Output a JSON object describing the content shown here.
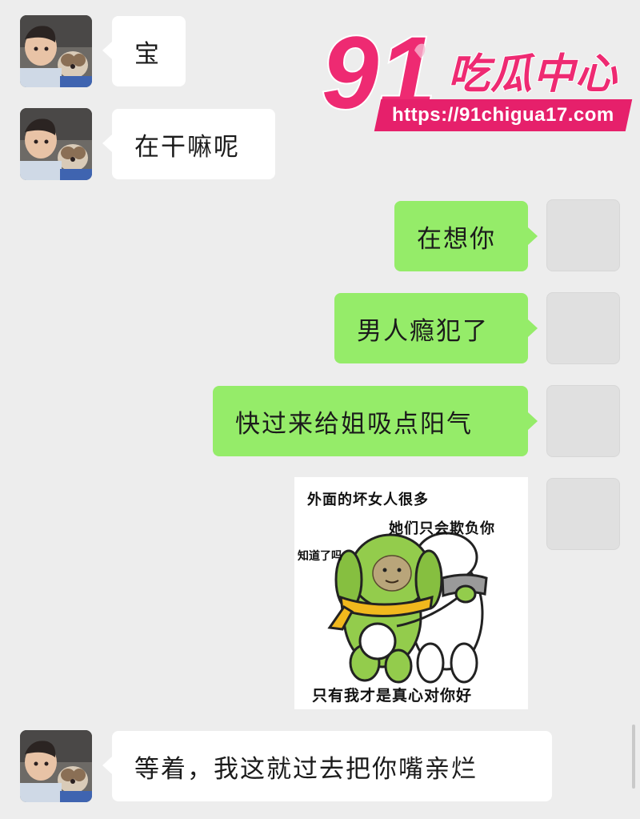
{
  "watermark": {
    "number": "91",
    "brand": "吃瓜中心",
    "url": "https://91chigua17.com"
  },
  "messages": [
    {
      "side": "in",
      "text": "宝"
    },
    {
      "side": "in",
      "text": "在干嘛呢"
    },
    {
      "side": "out",
      "text": "在想你"
    },
    {
      "side": "out",
      "text": "男人瘾犯了"
    },
    {
      "side": "out",
      "text": "快过来给姐吸点阳气"
    },
    {
      "side": "out",
      "type": "sticker"
    },
    {
      "side": "in",
      "text": "等着，我这就过去把你嘴亲烂"
    }
  ],
  "sticker": {
    "line1": "外面的坏女人很多",
    "line2": "她们只会欺负你",
    "side_text": "知道了吗",
    "caption": "只有我才是真心对你好"
  },
  "colors": {
    "background": "#ededed",
    "outgoing_bubble": "#95ec69",
    "incoming_bubble": "#ffffff",
    "watermark_pink": "#e6206b"
  }
}
